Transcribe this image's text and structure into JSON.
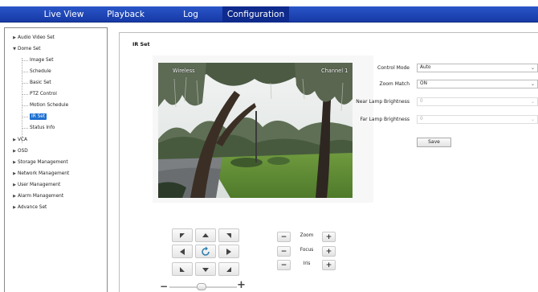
{
  "nav": {
    "items": [
      {
        "label": "Live View"
      },
      {
        "label": "Playback"
      },
      {
        "label": "Log"
      },
      {
        "label": "Configuration",
        "active": true
      }
    ]
  },
  "sidebar": {
    "items": [
      {
        "label": "Audio Video Set",
        "arrow": "▶"
      },
      {
        "label": "Dome Set",
        "arrow": "▼"
      },
      {
        "label": "Image Set"
      },
      {
        "label": "Schedule"
      },
      {
        "label": "Basic Set"
      },
      {
        "label": "PTZ Control"
      },
      {
        "label": "Motion Schedule"
      },
      {
        "label": "IR Set",
        "selected": true
      },
      {
        "label": "Status Info"
      },
      {
        "label": "VCA",
        "arrow": "▶"
      },
      {
        "label": "OSD",
        "arrow": "▶"
      },
      {
        "label": "Storage Management",
        "arrow": "▶"
      },
      {
        "label": "Network Management",
        "arrow": "▶"
      },
      {
        "label": "User Management",
        "arrow": "▶"
      },
      {
        "label": "Alarm Management",
        "arrow": "▶"
      },
      {
        "label": "Advance Set",
        "arrow": "▶"
      }
    ]
  },
  "section": {
    "title": "IR Set"
  },
  "video": {
    "osd_left": "Wireless",
    "osd_right": "Channel 1"
  },
  "form": {
    "control_mode": {
      "label": "Control Mode",
      "value": "Auto"
    },
    "zoom_match": {
      "label": "Zoom Match",
      "value": "ON"
    },
    "near_lamp": {
      "label": "Near Lamp Brightness",
      "value": "0"
    },
    "far_lamp": {
      "label": "Far Lamp Brightness",
      "value": "0"
    },
    "save_label": "Save"
  },
  "ptz": {
    "zoom_label": "Zoom",
    "focus_label": "Focus",
    "iris_label": "Iris",
    "minus": "−",
    "plus": "+"
  },
  "icons": {
    "arrow": "arrow-icon",
    "refresh": "auto-rotate-icon",
    "dropdown": "chevron-down-icon"
  },
  "colors": {
    "nav_bg": "#1e46b8",
    "nav_active": "#0e2a8c",
    "selected": "#1e6fd0"
  }
}
